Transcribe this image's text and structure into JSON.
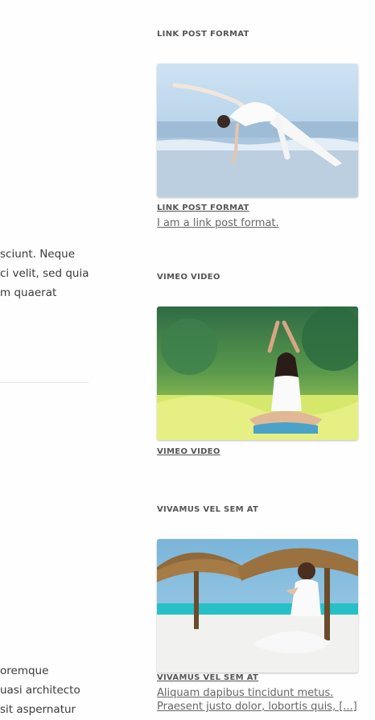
{
  "main_content": {
    "excerpt_top": [
      "sciunt. Neque",
      "ci velit, sed quia",
      "m quaerat"
    ],
    "excerpt_bottom": [
      "oremque",
      "uasi architecto",
      "sit aspernatur"
    ]
  },
  "sidebar": {
    "widgets": [
      {
        "heading": "LINK POST FORMAT",
        "image_icon": "yoga-beach-stretch-image",
        "post_title": "LINK POST FORMAT",
        "excerpt_lines": [
          "I am a link post format."
        ]
      },
      {
        "heading": "VIMEO VIDEO",
        "image_icon": "yoga-meadow-meditation-image",
        "post_title": "VIMEO VIDEO",
        "excerpt_lines": []
      },
      {
        "heading": "VIVAMUS VEL SEM AT",
        "image_icon": "yoga-beach-huts-image",
        "post_title": "VIVAMUS VEL SEM AT",
        "excerpt_lines": [
          "Aliquam dapibus tincidunt metus.",
          "Praesent justo dolor, lobortis quis, [...]"
        ]
      }
    ]
  },
  "colors": {
    "background": "#fefefe",
    "heading": "#555555",
    "link": "#666666",
    "body_text": "#3a3a3a"
  }
}
